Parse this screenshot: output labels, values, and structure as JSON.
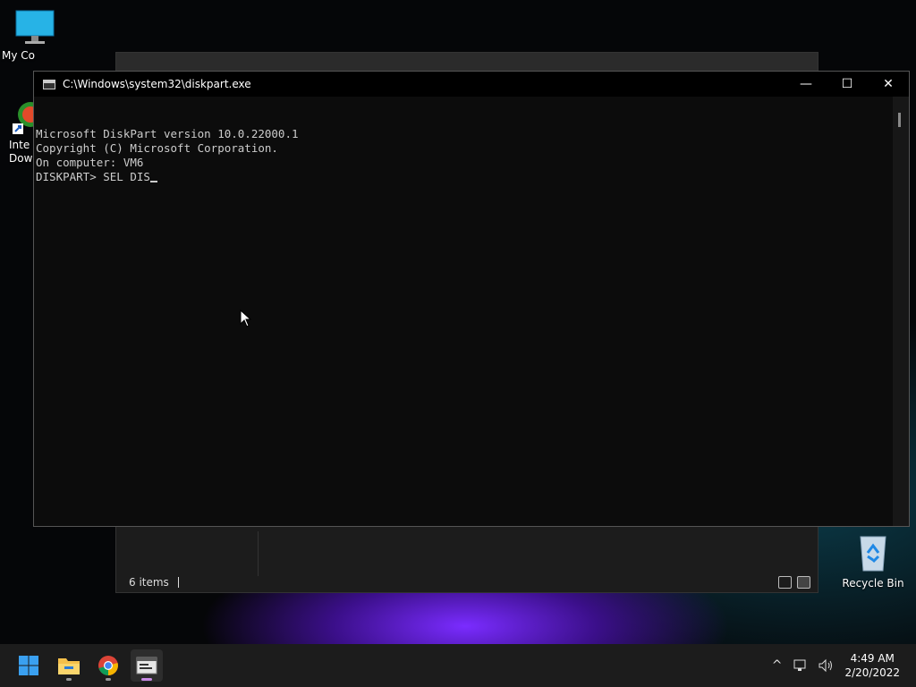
{
  "desktop": {
    "icons": [
      {
        "label": "My Co"
      },
      {
        "label": "Inte\nDow"
      },
      {
        "label": "Recycle Bin"
      }
    ]
  },
  "explorer": {
    "status_text": "6 items"
  },
  "console": {
    "title": "C:\\Windows\\system32\\diskpart.exe",
    "lines": [
      "Microsoft DiskPart version 10.0.22000.1",
      "",
      "Copyright (C) Microsoft Corporation.",
      "On computer: VM6",
      "",
      "DISKPART> SEL DIS"
    ],
    "minimize_glyph": "—",
    "maximize_glyph": "☐",
    "close_glyph": "✕"
  },
  "taskbar": {
    "items": [
      {
        "icon": "windows-start-icon"
      },
      {
        "icon": "file-explorer-icon"
      },
      {
        "icon": "chrome-icon"
      },
      {
        "icon": "diskpart-console-icon"
      }
    ],
    "tray": {
      "time": "4:49 AM",
      "date": "2/20/2022",
      "chevron_glyph": "^"
    }
  },
  "colors": {
    "console_bg": "#0c0c0c",
    "console_text": "#cccccc",
    "taskbar_bg": "#1c1c1c",
    "accent": "#7a2cff"
  }
}
